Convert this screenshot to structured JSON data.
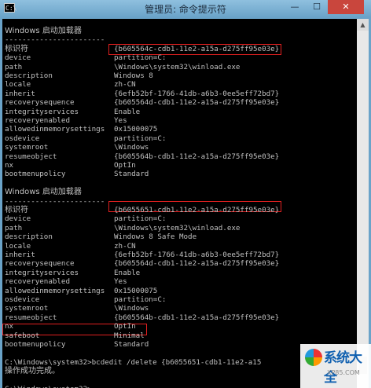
{
  "window": {
    "title": "管理员: 命令提示符",
    "icon_text": "C:\\",
    "min_glyph": "—",
    "max_glyph": "☐",
    "close_glyph": "✕"
  },
  "section1": {
    "header": "Windows 启动加载器",
    "separator": "-----------------------",
    "entries": [
      {
        "k": "标识符",
        "v": "{b605564c-cdb1-11e2-a15a-d275ff95e03e}",
        "cn": true
      },
      {
        "k": "device",
        "v": "partition=C:"
      },
      {
        "k": "path",
        "v": "\\Windows\\system32\\winload.exe"
      },
      {
        "k": "description",
        "v": "Windows 8"
      },
      {
        "k": "locale",
        "v": "zh-CN"
      },
      {
        "k": "inherit",
        "v": "{6efb52bf-1766-41db-a6b3-0ee5eff72bd7}"
      },
      {
        "k": "recoverysequence",
        "v": "{b605564d-cdb1-11e2-a15a-d275ff95e03e}"
      },
      {
        "k": "integrityservices",
        "v": "Enable"
      },
      {
        "k": "recoveryenabled",
        "v": "Yes"
      },
      {
        "k": "allowedinmemorysettings",
        "v": "0x15000075"
      },
      {
        "k": "osdevice",
        "v": "partition=C:"
      },
      {
        "k": "systemroot",
        "v": "\\Windows"
      },
      {
        "k": "resumeobject",
        "v": "{b605564b-cdb1-11e2-a15a-d275ff95e03e}"
      },
      {
        "k": "nx",
        "v": "OptIn"
      },
      {
        "k": "bootmenupolicy",
        "v": "Standard"
      }
    ]
  },
  "section2": {
    "header": "Windows 启动加载器",
    "separator": "-----------------------",
    "entries": [
      {
        "k": "标识符",
        "v": "{b6055651-cdb1-11e2-a15a-d275ff95e03e}",
        "cn": true
      },
      {
        "k": "device",
        "v": "partition=C:"
      },
      {
        "k": "path",
        "v": "\\Windows\\system32\\winload.exe"
      },
      {
        "k": "description",
        "v": "Windows 8 Safe Mode"
      },
      {
        "k": "locale",
        "v": "zh-CN"
      },
      {
        "k": "inherit",
        "v": "{6efb52bf-1766-41db-a6b3-0ee5eff72bd7}"
      },
      {
        "k": "recoverysequence",
        "v": "{b605564d-cdb1-11e2-a15a-d275ff95e03e}"
      },
      {
        "k": "integrityservices",
        "v": "Enable"
      },
      {
        "k": "recoveryenabled",
        "v": "Yes"
      },
      {
        "k": "allowedinmemorysettings",
        "v": "0x15000075"
      },
      {
        "k": "osdevice",
        "v": "partition=C:"
      },
      {
        "k": "systemroot",
        "v": "\\Windows"
      },
      {
        "k": "resumeobject",
        "v": "{b605564b-cdb1-11e2-a15a-d275ff95e03e}"
      },
      {
        "k": "nx",
        "v": "OptIn"
      },
      {
        "k": "safeboot",
        "v": "Minimal"
      },
      {
        "k": "bootmenupolicy",
        "v": "Standard"
      }
    ]
  },
  "command": {
    "line": "C:\\Windows\\system32>bcdedit /delete {b6055651-cdb1-11e2-a15",
    "result": "操作成功完成。",
    "prompt": "C:\\Windows\\system32>"
  },
  "watermark": {
    "text": "系统大全",
    "url": "XP85.COM"
  },
  "colors": {
    "console_bg": "#000000",
    "console_text": "#c0c0c0",
    "highlight_box": "#e02020",
    "titlebar": "#6aa3c9",
    "close_button": "#c9463d"
  }
}
